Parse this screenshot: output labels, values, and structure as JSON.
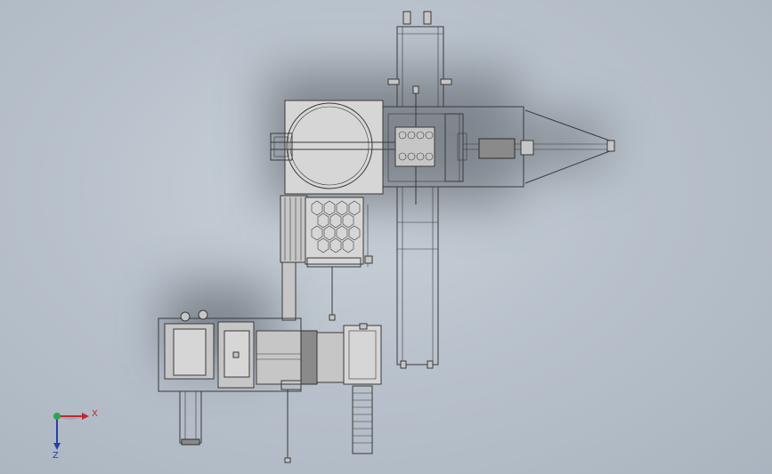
{
  "triad": {
    "x_label": "X",
    "z_label": "Z",
    "colors": {
      "x": "#c0282d",
      "y": "#2ea44f",
      "z": "#2a3ea8"
    }
  }
}
